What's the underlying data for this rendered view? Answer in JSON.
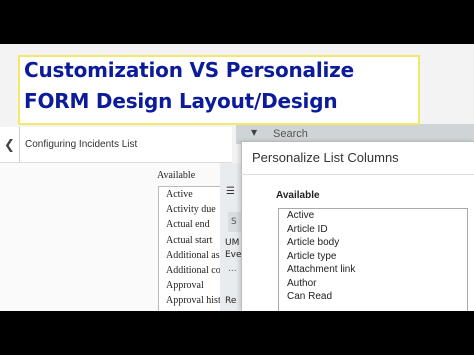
{
  "title_banner": {
    "line1": "Customization VS Personalize",
    "line2": "FORM Design Layout/Design",
    "text_color": "#0b1b9a",
    "highlight_color": "#f4e86a"
  },
  "background_page": {
    "header_title": "Configuring Incidents List",
    "search_placeholder": "Search",
    "available_label": "Available",
    "available_items": [
      "Active",
      "Activity due",
      "Actual end",
      "Actual start",
      "Additional as",
      "Additional co",
      "Approval",
      "Approval hist"
    ],
    "side_fragments": {
      "tab": "S",
      "row1": "UM",
      "row2": "Eve",
      "row3": "...",
      "row4": "Re"
    }
  },
  "modal": {
    "title": "Personalize List Columns",
    "available_label": "Available",
    "items": [
      "Active",
      "Article ID",
      "Article body",
      "Article type",
      "Attachment link",
      "Author",
      "Can Read"
    ]
  },
  "icons": {
    "back": "chevron-left-icon",
    "dropdown": "caret-down-icon",
    "menu": "hamburger-menu-icon"
  }
}
